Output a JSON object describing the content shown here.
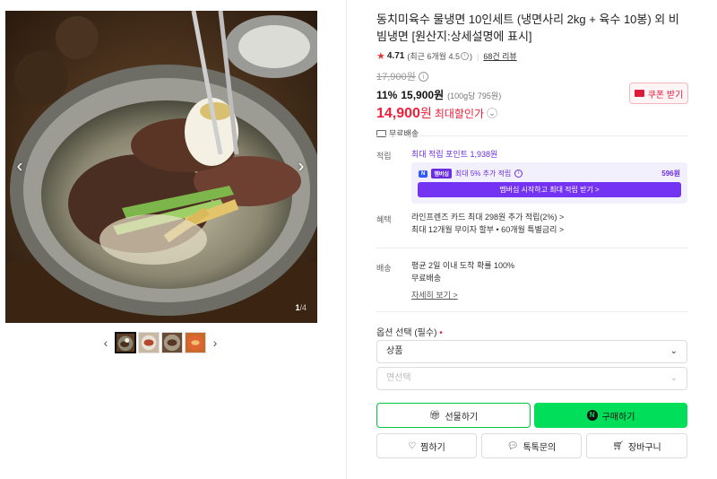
{
  "gallery": {
    "counter_current": "1",
    "counter_total": "/4",
    "prev_arrow": "‹",
    "next_arrow": "›",
    "thumb_prev": "‹",
    "thumb_next": "›"
  },
  "product": {
    "title": "동치미육수 물냉면 10인세트 (냉면사리 2kg + 육수 10봉) 외 비빔냉면 [원산지:상세설명에 표시]",
    "rating": "4.71",
    "rating_note": "(최근 6개월 4.5",
    "rating_note_tail": ")",
    "review_count": "68건 리뷰",
    "original_price": "17,900원",
    "discount_rate": "11%",
    "sale_price": "15,900원",
    "unit_price": "(100g당 795원)",
    "max_price_num": "14,900",
    "max_price_won": "원",
    "max_label": "최대할인가",
    "coupon_label": "쿠폰 받기",
    "free_shipping": "무료배송"
  },
  "points": {
    "label": "적립",
    "max_points": "최대 적립 포인트 1,938원",
    "member_text": "최대 5% 추가 적립",
    "member_amount": "596원",
    "badge1": "N",
    "badge2": "멤버십",
    "member_button": "멤버십 시작하고 최대 적립 받기 >"
  },
  "benefits": {
    "label": "혜택",
    "line1": "라인프렌즈 카드 최대 298원 추가 적립(2%) >",
    "line2": "최대 12개월 무이자 할부 • 60개월 특별금리 >"
  },
  "delivery": {
    "label": "배송",
    "line1": "평균 2일 이내 도착 확률 100%",
    "line2": "무료배송",
    "details_link": "자세히 보기 >"
  },
  "options": {
    "title": "옵션 선택 (필수)",
    "required_mark": "•",
    "select1": "상품",
    "select2": "면선택"
  },
  "actions": {
    "gift": "선물하기",
    "buy": "구매하기",
    "n_mark": "N",
    "wish": "찜하기",
    "talk": "톡톡문의",
    "cart": "장바구니"
  },
  "colors": {
    "sale_red": "#f0203a",
    "naver_green": "#00de5a",
    "membership_purple": "#7433f2"
  }
}
